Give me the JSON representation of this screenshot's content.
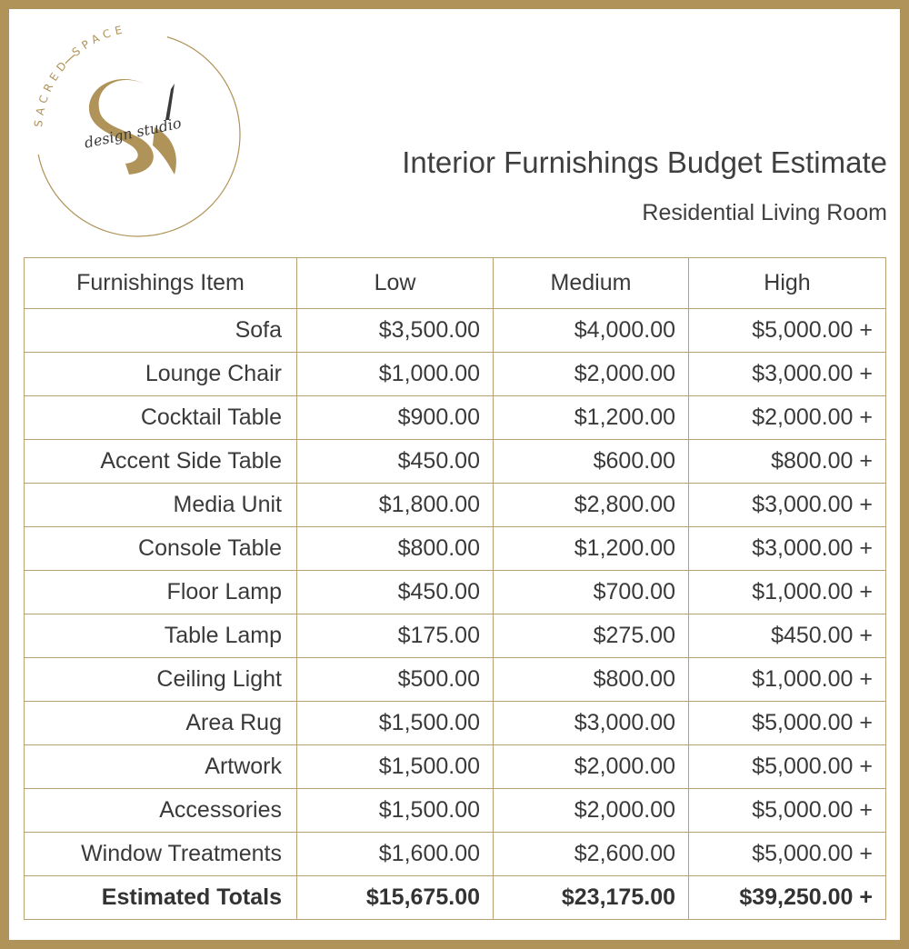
{
  "brand": {
    "name_top": "SACRED SPACE",
    "name_script": "design studio",
    "monogram": "S",
    "colors": {
      "gold": "#b09359",
      "text": "#3a3a3a"
    }
  },
  "header": {
    "title": "Interior Furnishings Budget Estimate",
    "subtitle": "Residential Living Room"
  },
  "table": {
    "columns": [
      "Furnishings Item",
      "Low",
      "Medium",
      "High"
    ],
    "rows": [
      {
        "item": "Sofa",
        "low": "$3,500.00",
        "medium": "$4,000.00",
        "high": "$5,000.00 +"
      },
      {
        "item": "Lounge Chair",
        "low": "$1,000.00",
        "medium": "$2,000.00",
        "high": "$3,000.00 +"
      },
      {
        "item": "Cocktail Table",
        "low": "$900.00",
        "medium": "$1,200.00",
        "high": "$2,000.00 +"
      },
      {
        "item": "Accent Side Table",
        "low": "$450.00",
        "medium": "$600.00",
        "high": "$800.00 +"
      },
      {
        "item": "Media Unit",
        "low": "$1,800.00",
        "medium": "$2,800.00",
        "high": "$3,000.00 +"
      },
      {
        "item": "Console Table",
        "low": "$800.00",
        "medium": "$1,200.00",
        "high": "$3,000.00 +"
      },
      {
        "item": "Floor Lamp",
        "low": "$450.00",
        "medium": "$700.00",
        "high": "$1,000.00 +"
      },
      {
        "item": "Table Lamp",
        "low": "$175.00",
        "medium": "$275.00",
        "high": "$450.00 +"
      },
      {
        "item": "Ceiling Light",
        "low": "$500.00",
        "medium": "$800.00",
        "high": "$1,000.00 +"
      },
      {
        "item": "Area Rug",
        "low": "$1,500.00",
        "medium": "$3,000.00",
        "high": "$5,000.00 +"
      },
      {
        "item": "Artwork",
        "low": "$1,500.00",
        "medium": "$2,000.00",
        "high": "$5,000.00 +"
      },
      {
        "item": "Accessories",
        "low": "$1,500.00",
        "medium": "$2,000.00",
        "high": "$5,000.00 +"
      },
      {
        "item": "Window Treatments",
        "low": "$1,600.00",
        "medium": "$2,600.00",
        "high": "$5,000.00 +"
      }
    ],
    "totals": {
      "item": "Estimated Totals",
      "low": "$15,675.00",
      "medium": "$23,175.00",
      "high": "$39,250.00 +"
    }
  }
}
